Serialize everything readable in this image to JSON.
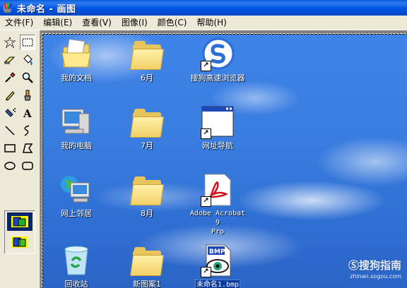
{
  "window": {
    "title": "未命名 - 画图"
  },
  "menu": [
    "文件(F)",
    "编辑(E)",
    "查看(V)",
    "图像(I)",
    "颜色(C)",
    "帮助(H)"
  ],
  "tools": [
    {
      "name": "free-select-icon",
      "glyph": "✧"
    },
    {
      "name": "rect-select-icon",
      "glyph": "⬚",
      "selected": true
    },
    {
      "name": "eraser-icon",
      "glyph": "▱"
    },
    {
      "name": "fill-bucket-icon",
      "glyph": "⛽"
    },
    {
      "name": "color-picker-icon",
      "glyph": "✎"
    },
    {
      "name": "magnifier-icon",
      "glyph": "🔍"
    },
    {
      "name": "pencil-icon",
      "glyph": "✏"
    },
    {
      "name": "brush-icon",
      "glyph": "🖌"
    },
    {
      "name": "airbrush-icon",
      "glyph": "✑"
    },
    {
      "name": "text-icon",
      "glyph": "A"
    },
    {
      "name": "line-icon",
      "glyph": "╲"
    },
    {
      "name": "curve-icon",
      "glyph": "∫"
    },
    {
      "name": "rectangle-icon",
      "glyph": "▭"
    },
    {
      "name": "polygon-icon",
      "glyph": "⏥"
    },
    {
      "name": "ellipse-icon",
      "glyph": "⬭"
    },
    {
      "name": "rounded-rect-icon",
      "glyph": "▢"
    }
  ],
  "desktop_icons": [
    {
      "label": "我的文档",
      "type": "my-documents"
    },
    {
      "label": "6月",
      "type": "folder"
    },
    {
      "label": "搜狗高速浏览器",
      "type": "sogou-browser",
      "shortcut": true
    },
    {
      "label": "我的电脑",
      "type": "my-computer"
    },
    {
      "label": "7月",
      "type": "folder"
    },
    {
      "label": "网址导航",
      "type": "window-shortcut",
      "shortcut": true
    },
    {
      "label": "网上邻居",
      "type": "network"
    },
    {
      "label": "8月",
      "type": "folder"
    },
    {
      "label": "Adobe Acrobat 9\nPro",
      "type": "acrobat",
      "shortcut": true,
      "mono": true
    },
    {
      "label": "回收站",
      "type": "recycle-bin"
    },
    {
      "label": "新图案1",
      "type": "folder"
    },
    {
      "label": "未命名1.bmp",
      "type": "bmp-file",
      "shortcut": true,
      "mono": true,
      "highlighted": true
    }
  ],
  "watermark": {
    "text": "搜狗指南",
    "url": "zhinan.sogou.com"
  }
}
